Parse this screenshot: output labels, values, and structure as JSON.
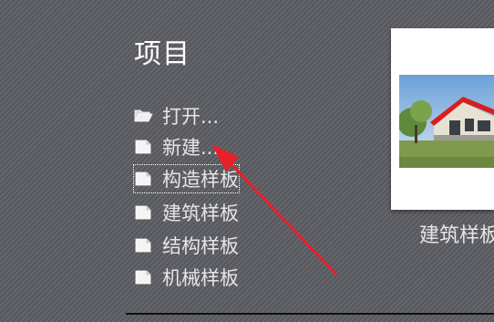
{
  "section": {
    "title": "项目"
  },
  "menu": {
    "items": [
      {
        "label": "打开...",
        "icon": "folder-open-icon"
      },
      {
        "label": "新建...",
        "icon": "document-icon"
      },
      {
        "label": "构造样板",
        "icon": "document-icon"
      },
      {
        "label": "建筑样板",
        "icon": "document-icon"
      },
      {
        "label": "结构样板",
        "icon": "document-icon"
      },
      {
        "label": "机械样板",
        "icon": "document-icon"
      }
    ]
  },
  "preview": {
    "caption": "建筑样板"
  },
  "colors": {
    "annotation_arrow": "#e8202a",
    "roof": "#d81e1e"
  }
}
